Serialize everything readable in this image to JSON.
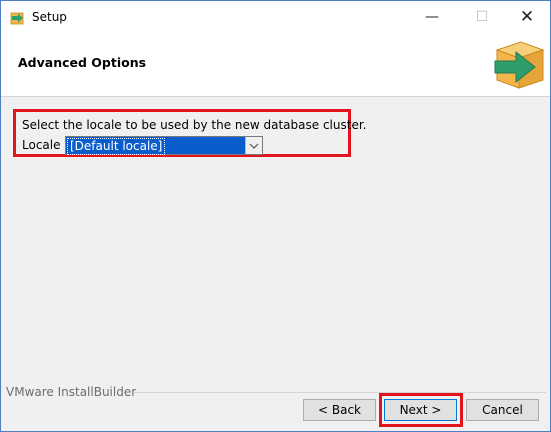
{
  "window": {
    "title": "Setup",
    "min_glyph": "—",
    "max_glyph": "☐",
    "close_glyph": "✕"
  },
  "header": {
    "title": "Advanced Options"
  },
  "content": {
    "prompt": "Select the locale to be used by the new database cluster.",
    "locale_label": "Locale",
    "locale_value": "[Default locale]"
  },
  "footer": {
    "brand": "VMware InstallBuilder",
    "back_label": "< Back",
    "next_label": "Next >",
    "cancel_label": "Cancel"
  },
  "colors": {
    "highlight": "#e2141d",
    "selection": "#0a5dcc",
    "logo_box": "#f2b64a",
    "logo_arrow": "#2f9e6b"
  }
}
